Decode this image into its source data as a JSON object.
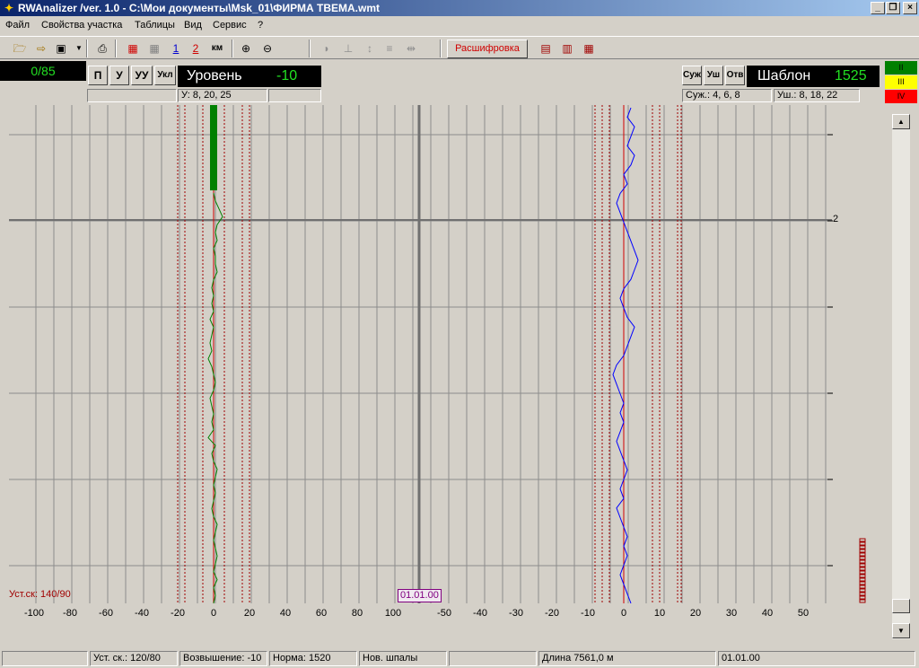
{
  "window": {
    "title": "RWAnalizer /ver. 1.0 - C:\\Мои документы\\Msk_01\\ФИРМА    TBEMA.wmt",
    "minimize": "_",
    "maximize": "❐",
    "close": "×"
  },
  "menu": [
    "Файл",
    "Свойства участка",
    "Таблицы",
    "Вид",
    "Сервис",
    "?"
  ],
  "toolbar": {
    "decode_label": "Расшифровка",
    "btn_1": "1",
    "btn_2": "2",
    "btn_km": "км"
  },
  "left_panel": {
    "counter": "0/85",
    "buttons": [
      "П",
      "У",
      "УУ",
      "Укл"
    ],
    "param_label": "Уровень",
    "param_value": "-10",
    "thresholds": "У: 8, 20, 25"
  },
  "right_panel": {
    "buttons": [
      "Суж",
      "Уш",
      "Отв"
    ],
    "param_label": "Шаблон",
    "param_value": "1525",
    "narrow_thresholds": "Суж.: 4, 6, 8",
    "wide_thresholds": "Уш.: 8, 18, 22"
  },
  "classes": [
    {
      "label": "II",
      "color": "#008000"
    },
    {
      "label": "III",
      "color": "#ffff00"
    },
    {
      "label": "IV",
      "color": "#ff0000"
    }
  ],
  "chart": {
    "speed_label": "Уст.ск: 140/90",
    "date_marker": "01.01.00",
    "km_marker": "2",
    "left_ticks": [
      "-100",
      "-80",
      "-60",
      "-40",
      "-20",
      "0",
      "20",
      "40",
      "60",
      "80",
      "100"
    ],
    "right_ticks": [
      "-50",
      "-40",
      "-30",
      "-20",
      "-10",
      "0",
      "10",
      "20",
      "30",
      "40",
      "50"
    ]
  },
  "chart_data": {
    "type": "line",
    "series": [
      {
        "axis": "left",
        "color": "#008000",
        "values": [
          0,
          1,
          3,
          5,
          2,
          1,
          2,
          0,
          1,
          1,
          2,
          0,
          -1,
          0,
          -1,
          0,
          -2,
          0,
          -1,
          -2,
          -1,
          -3,
          -1,
          0,
          1,
          0,
          -2,
          -1,
          0,
          -1,
          0,
          -3,
          1,
          -1,
          0,
          2,
          1,
          0,
          1,
          0,
          -1,
          0,
          2,
          1,
          0,
          1,
          2,
          1,
          0,
          2,
          0,
          1,
          0
        ]
      },
      {
        "axis": "right",
        "color": "#0000ff",
        "values": [
          2,
          1,
          3,
          2,
          1,
          3,
          2,
          0,
          1,
          -1,
          -2,
          -1,
          0,
          1,
          2,
          3,
          4,
          3,
          2,
          0,
          -1,
          0,
          1,
          3,
          2,
          1,
          0,
          -2,
          -3,
          -2,
          -1,
          0,
          -1,
          0,
          -1,
          -2,
          -1,
          0,
          1,
          0,
          -1,
          0,
          -2,
          -1,
          0,
          1,
          0,
          1,
          0,
          -1,
          0,
          1,
          2
        ]
      }
    ]
  },
  "status": {
    "speed": "Уст. ск.: 120/80",
    "elevation": "Возвышение: -10",
    "norm": "Норма: 1520",
    "sleepers": "Нов. шпалы",
    "length": "Длина 7561,0 м",
    "date": "01.01.00"
  }
}
